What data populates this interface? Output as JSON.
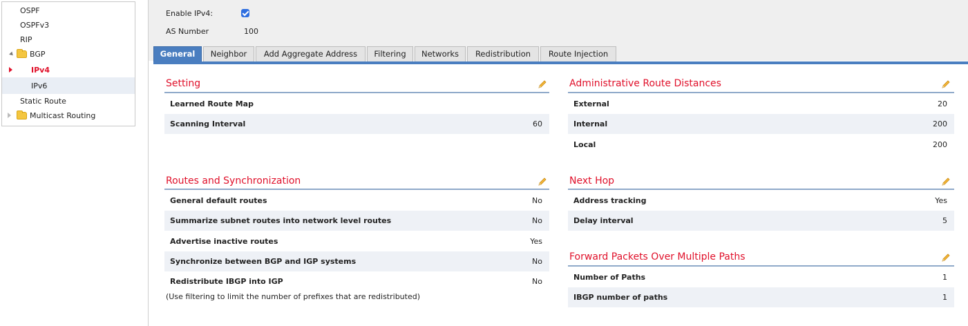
{
  "sidebar": {
    "items": [
      {
        "label": "OSPF"
      },
      {
        "label": "OSPFv3"
      },
      {
        "label": "RIP"
      },
      {
        "label": "BGP"
      },
      {
        "label": "IPv4"
      },
      {
        "label": "IPv6"
      },
      {
        "label": "Static Route"
      },
      {
        "label": "Multicast Routing"
      }
    ]
  },
  "header": {
    "enable_ipv4_label": "Enable IPv4:",
    "enable_ipv4_checked": true,
    "as_number_label": "AS Number",
    "as_number_value": "100"
  },
  "tabs": [
    {
      "label": "General",
      "active": true
    },
    {
      "label": "Neighbor"
    },
    {
      "label": "Add Aggregate Address"
    },
    {
      "label": "Filtering"
    },
    {
      "label": "Networks"
    },
    {
      "label": "Redistribution"
    },
    {
      "label": "Route Injection"
    }
  ],
  "sections": {
    "setting": {
      "title": "Setting",
      "rows": [
        {
          "key": "Learned Route Map",
          "value": ""
        },
        {
          "key": "Scanning Interval",
          "value": "60"
        }
      ]
    },
    "routes_sync": {
      "title": "Routes and Synchronization",
      "rows": [
        {
          "key": "General default routes",
          "value": "No"
        },
        {
          "key": "Summarize subnet routes into network level routes",
          "value": "No"
        },
        {
          "key": "Advertise inactive routes",
          "value": "Yes"
        },
        {
          "key": "Synchronize between BGP and IGP systems",
          "value": "No"
        },
        {
          "key": "Redistribute IBGP into IGP",
          "value": "No"
        }
      ],
      "note": "(Use filtering to limit the number of prefixes that are redistributed)"
    },
    "admin_distances": {
      "title": "Administrative Route Distances",
      "rows": [
        {
          "key": "External",
          "value": "20"
        },
        {
          "key": "Internal",
          "value": "200"
        },
        {
          "key": "Local",
          "value": "200"
        }
      ]
    },
    "next_hop": {
      "title": "Next Hop",
      "rows": [
        {
          "key": "Address tracking",
          "value": "Yes"
        },
        {
          "key": "Delay interval",
          "value": "5"
        }
      ]
    },
    "forward_packets": {
      "title": "Forward Packets Over Multiple Paths",
      "rows": [
        {
          "key": "Number of Paths",
          "value": "1"
        },
        {
          "key": "IBGP number of paths",
          "value": "1"
        }
      ]
    }
  },
  "colors": {
    "accent_red": "#e0102a",
    "tab_active": "#4a7ec0",
    "row_alt": "#eef1f6",
    "rule": "#8fa9c9"
  },
  "icons": {
    "edit": "pencil-icon",
    "folder": "folder-icon",
    "checkbox": "checkbox-checked-icon"
  }
}
